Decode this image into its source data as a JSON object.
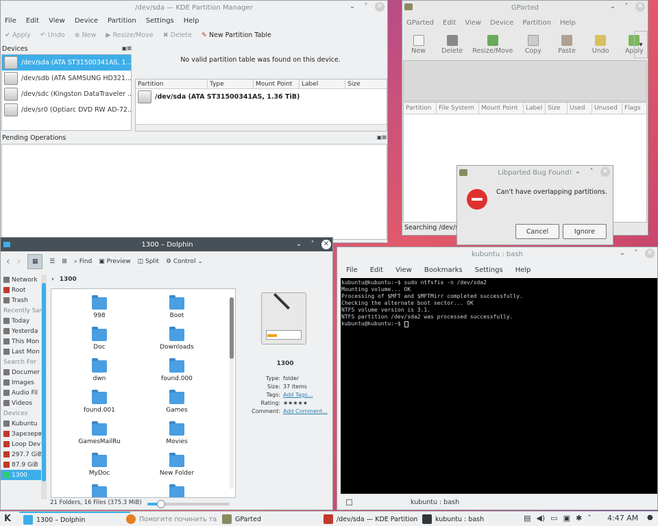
{
  "kde": {
    "title": "/dev/sda — KDE Partition Manager",
    "menu": [
      "File",
      "Edit",
      "View",
      "Device",
      "Partition",
      "Settings",
      "Help"
    ],
    "toolbar": {
      "apply": "Apply",
      "undo": "Undo",
      "new": "New",
      "resize": "Resize/Move",
      "delete": "Delete",
      "new_table": "New Partition Table"
    },
    "devices_title": "Devices",
    "devices": [
      "/dev/sda (ATA ST31500341AS, 1...",
      "/dev/sdb (ATA SAMSUNG HD321...",
      "/dev/sdc (Kingston DataTraveler ...",
      "/dev/sr0 (Optiarc DVD RW AD-72..."
    ],
    "no_table_msg": "No valid partition table was found on this device.",
    "columns": [
      "Partition",
      "Type",
      "Mount Point",
      "Label",
      "Size"
    ],
    "row": "/dev/sda (ATA ST31500341AS, 1.36 TiB)",
    "pending_title": "Pending Operations"
  },
  "gparted": {
    "title": "GParted",
    "menu": [
      "GParted",
      "Edit",
      "View",
      "Device",
      "Partition",
      "Help"
    ],
    "toolbar": [
      "New",
      "Delete",
      "Resize/Move",
      "Copy",
      "Paste",
      "Undo",
      "Apply"
    ],
    "columns": [
      "Partition",
      "File System",
      "Mount Point",
      "Label",
      "Size",
      "Used",
      "Unused",
      "Flags"
    ],
    "status": "Searching /dev/s"
  },
  "bug_dialog": {
    "title": "Libparted Bug Found!",
    "message": "Can't have overlapping partitions.",
    "cancel": "Cancel",
    "ignore": "Ignore"
  },
  "dolphin": {
    "title": "1300 – Dolphin",
    "toolbar": {
      "find": "Find",
      "preview": "Preview",
      "split": "Split",
      "control": "Control"
    },
    "breadcrumb": "1300",
    "sidebar": {
      "places": [
        "Network",
        "Root",
        "Trash"
      ],
      "recent_head": "Recently Sav",
      "recent": [
        "Today",
        "Yesterda",
        "This Mon",
        "Last Mon"
      ],
      "search_head": "Search For",
      "search": [
        "Documer",
        "Images",
        "Audio Fil",
        "Videos"
      ],
      "devices_head": "Devices",
      "devices": [
        "Kubuntu",
        "Зарезерв",
        "Loop Dev",
        "297.7 GiB",
        "87.9 GiB",
        "1300"
      ]
    },
    "files": [
      "998",
      "Boot",
      "Doc",
      "Downloads",
      "dwn",
      "found.000",
      "found.001",
      "Games",
      "GamesMailRu",
      "Movies",
      "MyDoc",
      "New Folder"
    ],
    "info": {
      "name": "1300",
      "type_label": "Type:",
      "type": "folder",
      "size_label": "Size:",
      "size": "37 items",
      "tags_label": "Tags:",
      "tags": "Add Tags...",
      "rating_label": "Rating:",
      "rating": "★★★★★",
      "comment_label": "Comment:",
      "comment": "Add Comment..."
    },
    "status": "21 Folders, 16 Files (375.3 MiB)"
  },
  "konsole": {
    "title": "kubuntu : bash",
    "menu": [
      "File",
      "Edit",
      "View",
      "Bookmarks",
      "Settings",
      "Help"
    ],
    "lines": [
      "kubuntu@kubuntu:~$ sudo ntfsfix -n /dev/sda2",
      "Mounting volume... OK",
      "Processing of $MFT and $MFTMirr completed successfully.",
      "Checking the alternate boot sector... OK",
      "NTFS volume version is 3.1.",
      "NTFS partition /dev/sda2 was processed successfully.",
      "kubuntu@kubuntu:~$ "
    ],
    "tab": "kubuntu : bash"
  },
  "taskbar": {
    "tasks": [
      "1300 – Dolphin",
      "Помогите починить та",
      "GParted",
      "/dev/sda — KDE Partition",
      "kubuntu : bash"
    ],
    "clock": "4:47 AM"
  }
}
